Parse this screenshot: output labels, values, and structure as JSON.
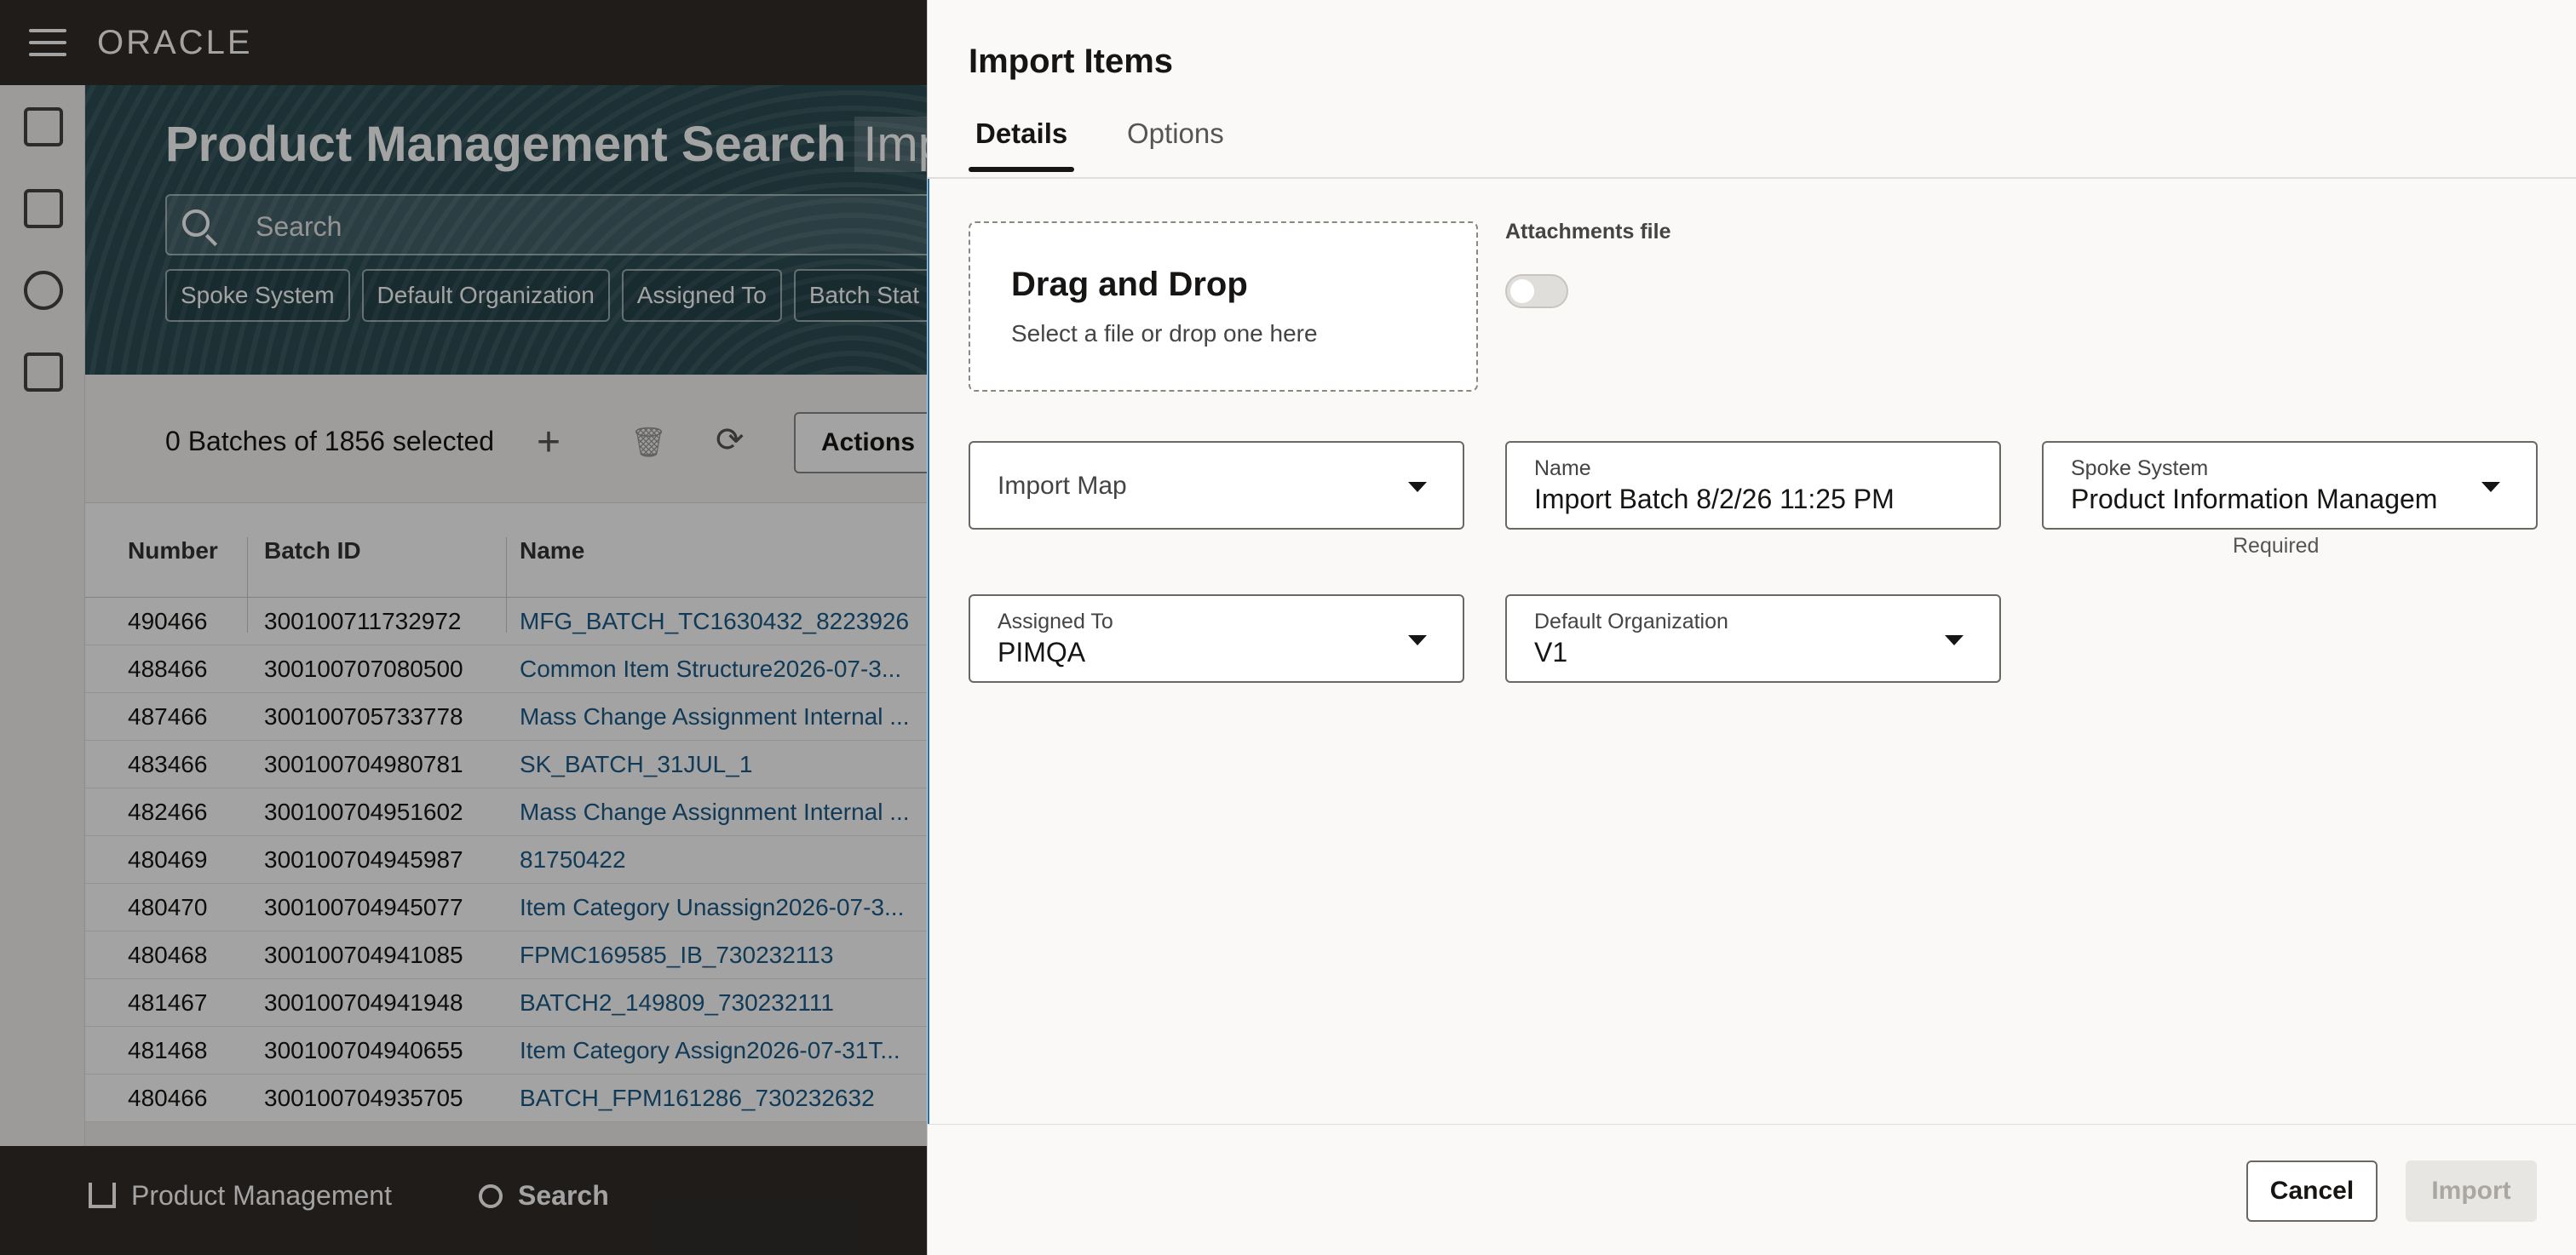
{
  "app": {
    "logo": "ORACLE"
  },
  "page": {
    "title": "Product Management Search",
    "title_tab": "Imp",
    "search_placeholder": "Search",
    "chips": [
      "Spoke System",
      "Default Organization",
      "Assigned To",
      "Batch Stat"
    ]
  },
  "toolbar": {
    "count_text": "0 Batches of 1856 selected",
    "actions_label": "Actions"
  },
  "table": {
    "headers": [
      "Number",
      "Batch ID",
      "Name"
    ],
    "rows": [
      [
        "490466",
        "300100711732972",
        "MFG_BATCH_TC1630432_8223926"
      ],
      [
        "488466",
        "300100707080500",
        "Common Item Structure2026-07-3..."
      ],
      [
        "487466",
        "300100705733778",
        "Mass Change Assignment Internal ..."
      ],
      [
        "483466",
        "300100704980781",
        "SK_BATCH_31JUL_1"
      ],
      [
        "482466",
        "300100704951602",
        "Mass Change Assignment Internal ..."
      ],
      [
        "480469",
        "300100704945987",
        "81750422"
      ],
      [
        "480470",
        "300100704945077",
        "Item Category Unassign2026-07-3..."
      ],
      [
        "480468",
        "300100704941085",
        "FPMC169585_IB_730232113"
      ],
      [
        "481467",
        "300100704941948",
        "BATCH2_149809_730232111"
      ],
      [
        "481468",
        "300100704940655",
        "Item Category Assign2026-07-31T..."
      ],
      [
        "480466",
        "300100704935705",
        "BATCH_FPM161286_730232632"
      ]
    ]
  },
  "bottom_nav": {
    "home_label": "Product Management",
    "search_label": "Search"
  },
  "drawer": {
    "title": "Import Items",
    "tabs": [
      "Details",
      "Options"
    ],
    "dropzone": {
      "title": "Drag and Drop",
      "subtitle": "Select a file or drop one here"
    },
    "attachments_label": "Attachments file",
    "import_map": {
      "placeholder": "Import Map",
      "helper": "Required"
    },
    "name": {
      "label": "Name",
      "value": "Import Batch 8/2/26 11:25 PM"
    },
    "spoke_system": {
      "label": "Spoke System",
      "value": "Product Information Managem"
    },
    "assigned_to": {
      "label": "Assigned To",
      "value": "PIMQA"
    },
    "default_org": {
      "label": "Default Organization",
      "value": "V1"
    },
    "cancel_label": "Cancel",
    "import_label": "Import"
  },
  "colors": {
    "header_bg": "#312d2a",
    "hero_bg": "#2b4d55",
    "link": "#1c5b88",
    "accent_border": "#1c73b8"
  }
}
